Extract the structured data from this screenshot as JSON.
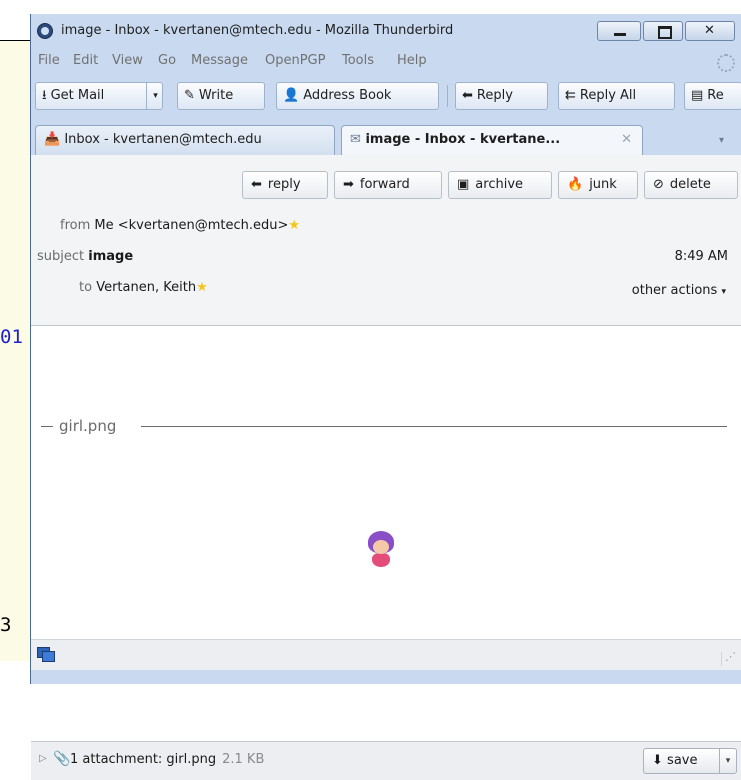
{
  "background": {
    "fragment_top": "01",
    "fragment_bottom": "3"
  },
  "window": {
    "title": "image - Inbox - kvertanen@mtech.edu - Mozilla Thunderbird"
  },
  "menu": {
    "items": [
      "File",
      "Edit",
      "View",
      "Go",
      "Message",
      "OpenPGP",
      "Tools",
      "Help"
    ]
  },
  "toolbar": {
    "get_mail": "Get Mail",
    "write": "Write",
    "address_book": "Address Book",
    "reply": "Reply",
    "reply_all": "Reply All",
    "next": "Re"
  },
  "tabs": [
    {
      "label": "Inbox - kvertanen@mtech.edu",
      "active": false
    },
    {
      "label": "image - Inbox - kvertane...",
      "active": true
    }
  ],
  "header_actions": {
    "reply": "reply",
    "forward": "forward",
    "archive": "archive",
    "junk": "junk",
    "delete": "delete"
  },
  "message": {
    "from_label": "from",
    "from_value": "Me <kvertanen@mtech.edu>",
    "subject_label": "subject",
    "subject_value": "image",
    "time": "8:49 AM",
    "to_label": "to",
    "to_value": "Vertanen, Keith",
    "other_actions": "other actions"
  },
  "body": {
    "attachment_caption": "girl.png"
  },
  "attachment_bar": {
    "summary": "1 attachment: girl.png",
    "size": "2.1 KB",
    "save": "save"
  },
  "colors": {
    "window_frame": "#c9daf0",
    "background_note": "#fcfce6",
    "link_blue": "#1f1fd0",
    "star": "#f5c518"
  }
}
